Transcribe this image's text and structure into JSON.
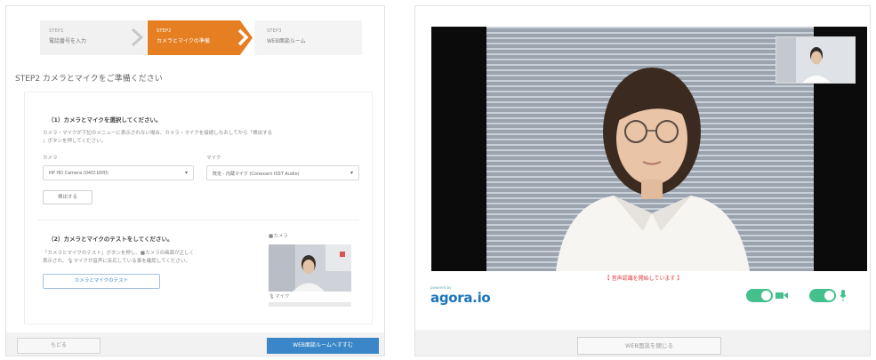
{
  "stepper": {
    "steps": [
      {
        "num": "STEP1",
        "label": "電話番号を入力"
      },
      {
        "num": "STEP2",
        "label": "カメラとマイクの準備"
      },
      {
        "num": "STEP3",
        "label": "WEB面談ルーム"
      }
    ]
  },
  "setup": {
    "title": "STEP2 カメラとマイクをご準備ください",
    "section1": {
      "title": "（1）カメラとマイクを選択してください。",
      "desc_line1": "カメラ・マイクが下記のメニューに表示されない場合、カメラ・マイクを接続しなおしてから「検出する",
      "desc_line2": "」ボタンを押してください。",
      "camera_label": "カメラ",
      "camera_value": "HP HD Camera (04f2:b5f0)",
      "mic_label": "マイク",
      "mic_value": "既定 - 内蔵マイク (Conexant ISST Audio)",
      "detect_label": "検出する"
    },
    "section2": {
      "title": "（2）カメラとマイクのテストをしてください。",
      "desc_line1": "「カメラとマイクのテスト」ボタンを押し、■カメラの画面が正しく",
      "desc_line2": "表示され、🎙マイクが音声に反応している事を確認してください。",
      "test_label": "カメラとマイクのテスト",
      "camera_tag": "■カメラ",
      "mic_tag": "🎙マイク"
    },
    "back_label": "もどる",
    "enter_label": "WEB面談ルームへすすむ"
  },
  "room": {
    "recording_note": "【 音声認識を開始しています 】",
    "powered_by": "powered by",
    "brand": "agora.io",
    "camera_toggle_on": true,
    "mic_toggle_on": true,
    "close_label": "WEB面談を閉じる"
  },
  "colors": {
    "accent": "#e67e22",
    "primary": "#3a86c8",
    "toggle": "#43c08c",
    "brand": "#1b75bb",
    "alert": "#e23b3b"
  }
}
